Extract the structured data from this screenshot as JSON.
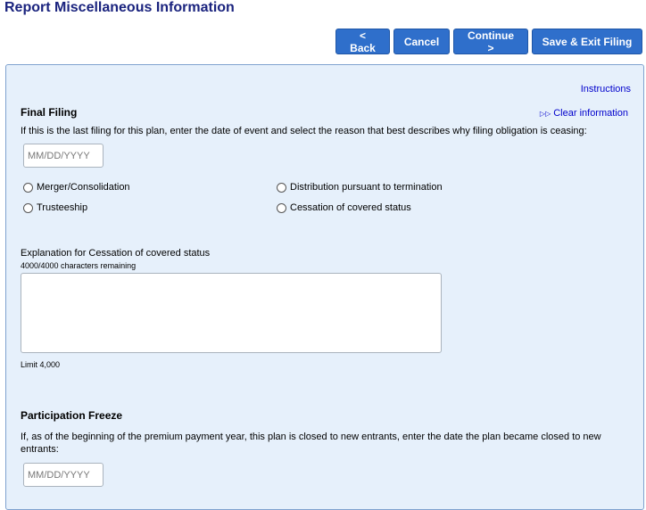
{
  "page": {
    "title": "Report Miscellaneous Information"
  },
  "toolbar": {
    "back_label": "< Back",
    "cancel_label": "Cancel",
    "continue_label": "Continue >",
    "save_exit_label": "Save & Exit Filing"
  },
  "links": {
    "instructions": "Instructions",
    "clear_information": "Clear information",
    "clear_icon": "double-chevron-right-icon"
  },
  "final_filing": {
    "title": "Final Filing",
    "description": "If this is the last filing for this plan, enter the date of event and select the reason that best describes why filing obligation is ceasing:",
    "date_placeholder": "MM/DD/YYYY",
    "reasons": [
      "Merger/Consolidation",
      "Trusteeship",
      "Distribution pursuant to termination",
      "Cessation of covered status"
    ],
    "explanation_label": "Explanation for Cessation of covered status",
    "chars_remaining": "4000/4000 characters remaining",
    "limit_text": "Limit 4,000"
  },
  "participation_freeze": {
    "title": "Participation Freeze",
    "description": "If, as of the beginning of the premium payment year, this plan is closed to new entrants, enter the date the plan became closed to new entrants:",
    "date_placeholder": "MM/DD/YYYY"
  },
  "colors": {
    "title": "#1a237e",
    "button_bg": "#2f6fcb",
    "panel_bg": "#e6f0fb",
    "panel_border": "#7fa2cf",
    "link": "#0000cc"
  }
}
